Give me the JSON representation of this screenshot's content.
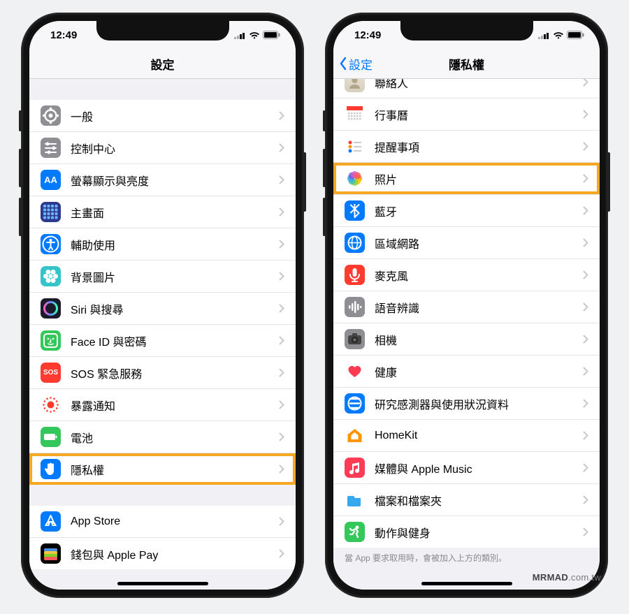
{
  "status_time": "12:49",
  "watermark_bold": "MRMAD",
  "watermark_rest": ".com.tw",
  "phone_left": {
    "title": "設定",
    "groups": [
      {
        "rows": [
          {
            "icon": "gear",
            "bg": "#8e8e93",
            "label": "一般"
          },
          {
            "icon": "sliders",
            "bg": "#8e8e93",
            "label": "控制中心"
          },
          {
            "icon": "AA",
            "bg": "#007aff",
            "label": "螢幕顯示與亮度"
          },
          {
            "icon": "grid",
            "bg": "#2d3a8c",
            "label": "主畫面"
          },
          {
            "icon": "access",
            "bg": "#007aff",
            "label": "輔助使用"
          },
          {
            "icon": "flower",
            "bg": "#35c4c9",
            "label": "背景圖片"
          },
          {
            "icon": "siri",
            "bg": "#1b1b2b",
            "label": "Siri 與搜尋"
          },
          {
            "icon": "faceid",
            "bg": "#34c759",
            "label": "Face ID 與密碼"
          },
          {
            "icon": "SOS",
            "bg": "#ff3b30",
            "label": "SOS 緊急服務"
          },
          {
            "icon": "exposure",
            "bg": "#ffffff",
            "label": "暴露通知"
          },
          {
            "icon": "battery",
            "bg": "#34c759",
            "label": "電池"
          },
          {
            "icon": "hand",
            "bg": "#007aff",
            "label": "隱私權",
            "hl": true
          }
        ]
      },
      {
        "rows": [
          {
            "icon": "appstore",
            "bg": "#007aff",
            "label": "App Store"
          },
          {
            "icon": "wallet",
            "bg": "#000000",
            "label": "錢包與 Apple Pay"
          }
        ]
      }
    ]
  },
  "phone_right": {
    "title": "隱私權",
    "back": "設定",
    "rows": [
      {
        "icon": "contacts",
        "bg": "#d9d2c6",
        "label": "聯絡人"
      },
      {
        "icon": "calendar",
        "bg": "#ffffff",
        "label": "行事曆"
      },
      {
        "icon": "reminders",
        "bg": "#ffffff",
        "label": "提醒事項"
      },
      {
        "icon": "photos",
        "bg": "#ffffff",
        "label": "照片",
        "hl": true
      },
      {
        "icon": "bluetooth",
        "bg": "#007aff",
        "label": "藍牙"
      },
      {
        "icon": "network",
        "bg": "#007aff",
        "label": "區域網路"
      },
      {
        "icon": "mic",
        "bg": "#ff3b30",
        "label": "麥克風"
      },
      {
        "icon": "speech",
        "bg": "#8e8e93",
        "label": "語音辨識"
      },
      {
        "icon": "camera",
        "bg": "#8e8e93",
        "label": "相機"
      },
      {
        "icon": "health",
        "bg": "#ffffff",
        "label": "健康"
      },
      {
        "icon": "research",
        "bg": "#007aff",
        "label": "研究感測器與使用狀況資料"
      },
      {
        "icon": "homekit",
        "bg": "#ffffff",
        "label": "HomeKit"
      },
      {
        "icon": "music",
        "bg": "#ff3b56",
        "label": "媒體與 Apple Music"
      },
      {
        "icon": "files",
        "bg": "#ffffff",
        "label": "檔案和檔案夾"
      },
      {
        "icon": "motion",
        "bg": "#34c759",
        "label": "動作與健身"
      }
    ],
    "footer": "當 App 要求取用時，會被加入上方的類別。"
  }
}
